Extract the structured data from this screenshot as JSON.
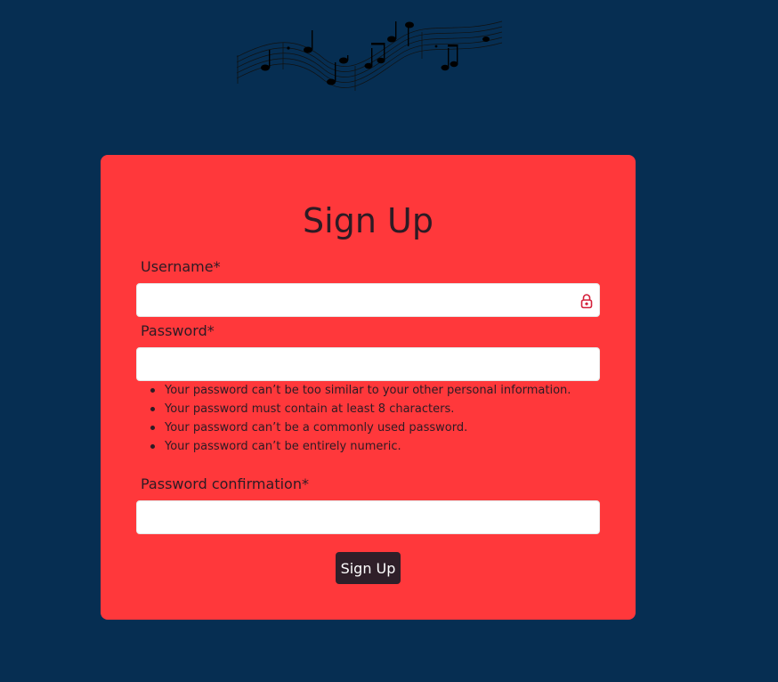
{
  "form": {
    "title": "Sign Up",
    "username_label": "Username*",
    "username_value": "",
    "password_label": "Password*",
    "password_value": "",
    "password_help": [
      "Your password can’t be too similar to your other personal information.",
      "Your password must contain at least 8 characters.",
      "Your password can’t be a commonly used password.",
      "Your password can’t be entirely numeric."
    ],
    "confirm_label": "Password confirmation*",
    "confirm_value": "",
    "submit_label": "Sign Up"
  },
  "icons": {
    "logo": "music-staff-notes-logo",
    "field_icon": "password-manager-lock-icon"
  },
  "colors": {
    "background": "#062e52",
    "card": "#ff383b",
    "text": "#2d1b24",
    "button": "#2f1f29",
    "button_text": "#ffffff",
    "field_icon": "#d4203a"
  }
}
